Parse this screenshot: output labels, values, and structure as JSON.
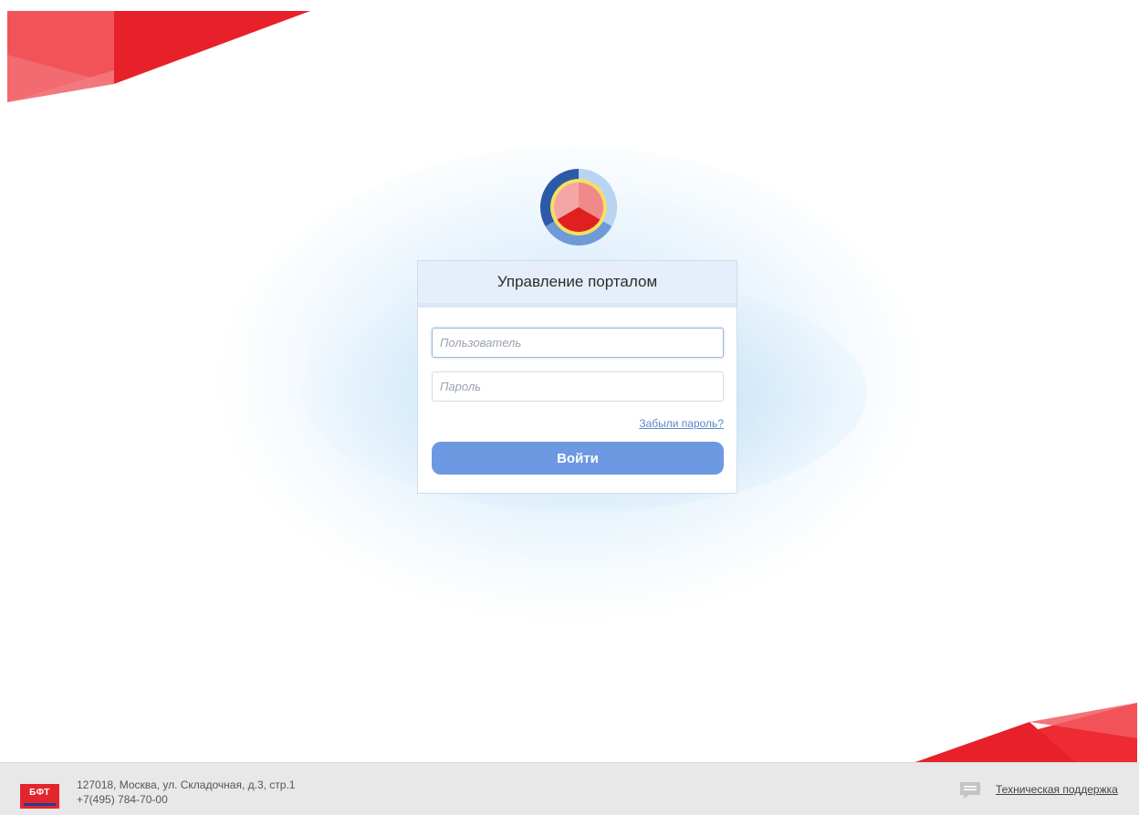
{
  "portal": {
    "title": "Управление порталом",
    "username_placeholder": "Пользователь",
    "password_placeholder": "Пароль",
    "forgot_password": "Забыли пароль?",
    "login_button": "Войти"
  },
  "footer": {
    "logo_text": "БФТ",
    "address": "127018, Москва, ул. Складочная, д.3, стр.1",
    "phone": "+7(495) 784-70-00",
    "support_link": "Техническая поддержка",
    "support_icon": "chat-icon"
  },
  "colors": {
    "brand_red": "#e3262e",
    "button_blue": "#6d98e2",
    "header_bg": "#e7eefb",
    "link_blue": "#5b87c9"
  }
}
